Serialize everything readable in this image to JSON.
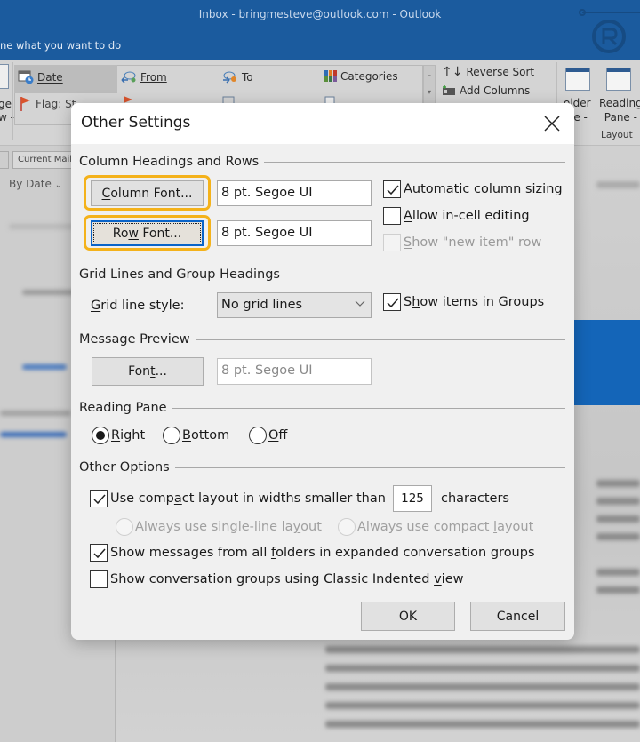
{
  "window": {
    "title": "Inbox - bringmesteve@outlook.com  -  Outlook",
    "tell_me": "ne what you want to do"
  },
  "ribbon": {
    "arrangement": [
      {
        "label": "Date",
        "icon": "calendar-clock-icon",
        "selected": true
      },
      {
        "label": "From",
        "icon": "from-person-icon"
      },
      {
        "label": "To",
        "icon": "to-person-icon"
      },
      {
        "label": "Categories",
        "icon": "categories-icon"
      },
      {
        "label": "Flag: St",
        "icon": "flag-icon"
      }
    ],
    "change_view_partial": [
      "ge",
      "w -"
    ],
    "reverse_sort": "Reverse Sort",
    "add_columns": "Add Columns",
    "folder_pane": [
      "older",
      "ne -"
    ],
    "reading_pane": [
      "Reading",
      "Pane -"
    ],
    "layout_group": "Layout"
  },
  "list_pane": {
    "scope": "Current Mail",
    "sort": "By Date"
  },
  "dialog": {
    "title": "Other Settings",
    "sections": {
      "column_headings": "Column Headings and Rows",
      "grid_lines": "Grid Lines and Group Headings",
      "message_preview": "Message Preview",
      "reading_pane": "Reading Pane",
      "other_options": "Other Options"
    },
    "column_font": {
      "button": {
        "pre": "",
        "u": "C",
        "post": "olumn Font..."
      },
      "value": "8 pt. Segoe UI"
    },
    "row_font": {
      "button": {
        "pre": "Ro",
        "u": "w",
        "post": " Font..."
      },
      "value": "8 pt. Segoe UI"
    },
    "automatic_column_sizing": {
      "pre": "Automatic column si",
      "u": "z",
      "post": "ing",
      "checked": true
    },
    "allow_in_cell_editing": {
      "pre": "",
      "u": "A",
      "post": "llow in-cell editing",
      "checked": false
    },
    "show_new_item_row": {
      "pre": "",
      "u": "S",
      "post": "how \"new item\" row",
      "checked": false,
      "disabled": true
    },
    "grid_line_style": {
      "label": {
        "pre": "",
        "u": "G",
        "post": "rid line style:"
      },
      "value": "No grid lines"
    },
    "show_items_in_groups": {
      "pre": "S",
      "u": "h",
      "post": "ow items in Groups",
      "checked": true
    },
    "preview_font": {
      "button": {
        "pre": "Fon",
        "u": "t",
        "post": "..."
      },
      "value": "8 pt. Segoe UI"
    },
    "reading_pane_options": [
      {
        "pre": "",
        "u": "R",
        "post": "ight",
        "selected": true
      },
      {
        "pre": "",
        "u": "B",
        "post": "ottom",
        "selected": false
      },
      {
        "pre": "",
        "u": "O",
        "post": "ff",
        "selected": false
      }
    ],
    "compact_layout": {
      "pre": "Use comp",
      "u": "a",
      "post": "ct layout in widths smaller than",
      "checked": true,
      "width_value": "125",
      "suffix": "characters"
    },
    "layout_modes": [
      {
        "pre": "Always use single-line la",
        "u": "y",
        "post": "out",
        "disabled": true
      },
      {
        "pre": "Always use compact ",
        "u": "l",
        "post": "ayout",
        "disabled": true
      }
    ],
    "show_all_folders": {
      "pre": "Show messages from all ",
      "u": "f",
      "post": "olders in expanded conversation groups",
      "checked": true
    },
    "classic_indented": {
      "pre": "Show conversation groups using Classic Indented ",
      "u": "v",
      "post": "iew",
      "checked": false
    },
    "ok": "OK",
    "cancel": "Cancel"
  },
  "colors": {
    "title_bar": "#1b5b9e",
    "focus_highlight": "#f4b21b",
    "focus_border": "#0a64c8"
  }
}
